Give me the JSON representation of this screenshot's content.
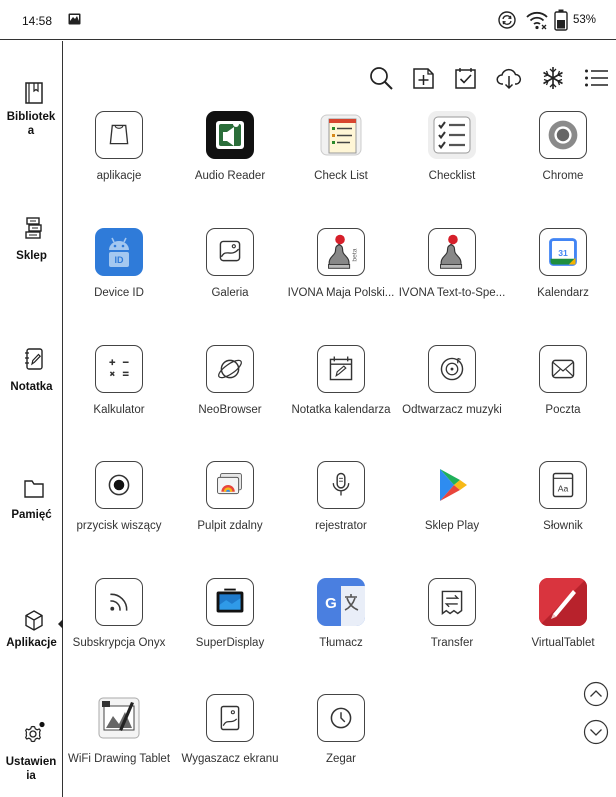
{
  "status_bar": {
    "time": "14:58",
    "battery_percent": "53%"
  },
  "sidebar": {
    "items": [
      {
        "label": "Bibliotek a",
        "icon": "library-icon"
      },
      {
        "label": "Sklep",
        "icon": "store-icon"
      },
      {
        "label": "Notatka",
        "icon": "notes-icon"
      },
      {
        "label": "Pamięć",
        "icon": "folder-icon"
      },
      {
        "label": "Aplikacje",
        "icon": "apps-cube-icon"
      },
      {
        "label": "Ustawien ia",
        "icon": "settings-gear-icon"
      }
    ],
    "active": "Aplikacje"
  },
  "toolbar": {
    "icons": [
      "search-icon",
      "add-folder-icon",
      "multi-select-icon",
      "cloud-download-icon",
      "freeze-icon",
      "list-view-icon"
    ]
  },
  "apps": [
    {
      "label": "aplikacje",
      "icon": "folder-app-icon"
    },
    {
      "label": "Audio Reader",
      "icon": "audio-reader-icon"
    },
    {
      "label": "Check List",
      "icon": "check-list-notepad-icon"
    },
    {
      "label": "Checklist",
      "icon": "checklist-icon"
    },
    {
      "label": "Chrome",
      "icon": "chrome-icon"
    },
    {
      "label": "Device ID",
      "icon": "android-device-id-icon",
      "badge": "ID"
    },
    {
      "label": "Galeria",
      "icon": "gallery-icon"
    },
    {
      "label": "IVONA Maja Polski...",
      "icon": "ivona-joystick-icon",
      "badge": "beta"
    },
    {
      "label": "IVONA Text-to-Spe...",
      "icon": "ivona-joystick-icon"
    },
    {
      "label": "Kalendarz",
      "icon": "calendar-icon",
      "badge": "31"
    },
    {
      "label": "Kalkulator",
      "icon": "calculator-icon"
    },
    {
      "label": "NeoBrowser",
      "icon": "planet-browser-icon"
    },
    {
      "label": "Notatka kalendarza",
      "icon": "calendar-note-icon"
    },
    {
      "label": "Odtwarzacz muzyki",
      "icon": "music-player-icon"
    },
    {
      "label": "Poczta",
      "icon": "mail-icon"
    },
    {
      "label": "przycisk wiszący",
      "icon": "floating-button-icon"
    },
    {
      "label": "Pulpit zdalny",
      "icon": "remote-desktop-icon"
    },
    {
      "label": "rejestrator",
      "icon": "recorder-mic-icon"
    },
    {
      "label": "Sklep Play",
      "icon": "play-store-icon"
    },
    {
      "label": "Słownik",
      "icon": "dictionary-icon",
      "badge": "Aa"
    },
    {
      "label": "Subskrypcja Onyx",
      "icon": "rss-icon"
    },
    {
      "label": "SuperDisplay",
      "icon": "superdisplay-icon"
    },
    {
      "label": "Tłumacz",
      "icon": "translate-icon"
    },
    {
      "label": "Transfer",
      "icon": "transfer-icon"
    },
    {
      "label": "VirtualTablet",
      "icon": "virtualtablet-icon"
    },
    {
      "label": "WiFi Drawing Tablet",
      "icon": "wifi-drawing-tablet-icon"
    },
    {
      "label": "Wygaszacz ekranu",
      "icon": "screensaver-icon"
    },
    {
      "label": "Zegar",
      "icon": "clock-icon"
    }
  ],
  "pager": {
    "up": "scroll-up-icon",
    "down": "scroll-down-icon"
  },
  "colors": {
    "android_blue": "#2F7BD9",
    "play_green": "#20B05A",
    "play_blue": "#2E8CF0",
    "play_yellow": "#F7B917",
    "play_red": "#E8453C",
    "calendar_blue": "#4285F4",
    "translate_blue": "#4A7FE0",
    "virtualtablet_red": "#D9343E",
    "ivona_red": "#D61F2A"
  }
}
